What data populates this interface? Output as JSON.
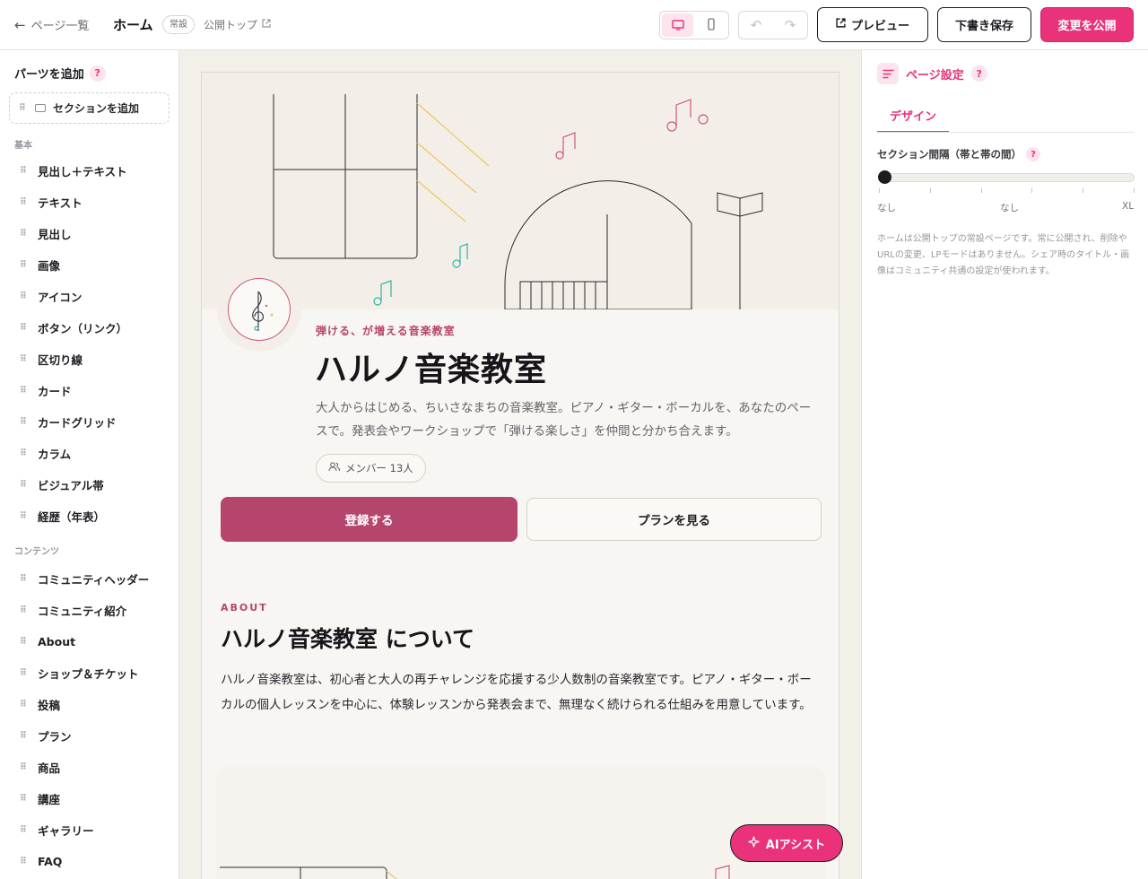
{
  "topbar": {
    "back_label": "ページ一覧",
    "page_title": "ホーム",
    "badge": "常設",
    "public_link": "公開トップ",
    "preview_label": "プレビュー",
    "draft_label": "下書き保存",
    "publish_label": "変更を公開",
    "device_active": "desktop"
  },
  "sidebar": {
    "header": "パーツを追加",
    "add_section": "セクションを追加",
    "groups": [
      {
        "label": "基本",
        "items": [
          "見出し＋テキスト",
          "テキスト",
          "見出し",
          "画像",
          "アイコン",
          "ボタン（リンク）",
          "区切り線",
          "カード",
          "カードグリッド",
          "カラム",
          "ビジュアル帯",
          "経歴（年表）"
        ]
      },
      {
        "label": "コンテンツ",
        "items": [
          "コミュニティヘッダー",
          "コミュニティ紹介",
          "About",
          "ショップ＆チケット",
          "投稿",
          "プラン",
          "商品",
          "講座",
          "ギャラリー",
          "FAQ"
        ]
      }
    ]
  },
  "canvas": {
    "tagline": "弾ける、が増える音楽教室",
    "title": "ハルノ音楽教室",
    "description": "大人からはじめる、ちいさなまちの音楽教室。ピアノ・ギター・ボーカルを、あなたのペースで。発表会やワークショップで「弾ける楽しさ」を仲間と分かち合えます。",
    "member_count": "メンバー 13人",
    "register_label": "登録する",
    "plans_label": "プランを見る",
    "about_label": "ABOUT",
    "about_title": "ハルノ音楽教室 について",
    "about_body": "ハルノ音楽教室は、初心者と大人の再チャレンジを応援する少人数制の音楽教室です。ピアノ・ギター・ボーカルの個人レッスンを中心に、体験レッスンから発表会まで、無理なく続けられる仕組みを用意しています。"
  },
  "panel": {
    "title": "ページ設定",
    "tab": "デザイン",
    "spacing_label": "セクション間隔（帯と帯の間）",
    "scale_min": "なし",
    "scale_mid": "なし",
    "scale_max": "XL",
    "note": "ホームは公開トップの常設ページです。常に公開され、削除やURLの変更、LPモードはありません。シェア時のタイトル・画像はコミュニティ共通の設定が使われます。"
  },
  "ai_button": "AIアシスト",
  "colors": {
    "accent": "#e9327a",
    "brand": "#b5456c",
    "text": "#1c1b20"
  },
  "icons": [
    "arrow-left-icon",
    "external-link-icon",
    "desktop-icon",
    "mobile-icon",
    "undo-icon",
    "redo-icon",
    "preview-icon",
    "help-icon",
    "grip-icon",
    "section-icon",
    "users-icon",
    "settings-icon",
    "sparkle-icon"
  ]
}
